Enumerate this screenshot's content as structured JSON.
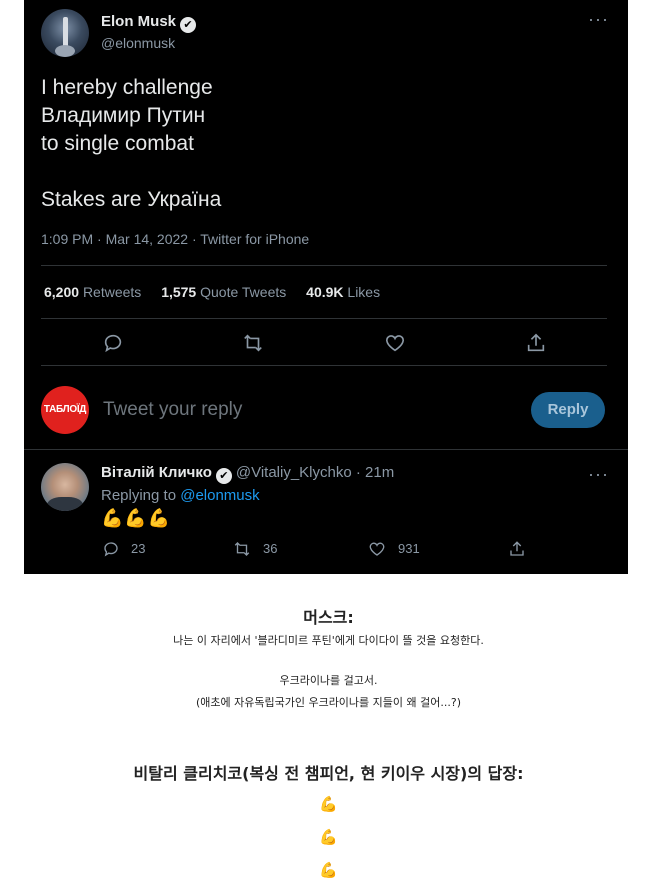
{
  "tweet": {
    "author_name": "Elon Musk",
    "author_handle": "@elonmusk",
    "verified_badge": "✔",
    "lines": [
      "I hereby challenge",
      "Владимир Путин",
      "to single combat",
      "Stakes are Україна"
    ],
    "meta": "1:09 PM · Mar 14, 2022 · Twitter for iPhone",
    "stats": {
      "retweets_count": "6,200",
      "retweets_label": "Retweets",
      "quotes_count": "1,575",
      "quotes_label": "Quote Tweets",
      "likes_count": "40.9K",
      "likes_label": "Likes"
    },
    "more_icon": "···"
  },
  "reply_box": {
    "avatar_text": "ТАБЛОЇД",
    "placeholder": "Tweet your reply",
    "button_label": "Reply"
  },
  "reply_tweet": {
    "author_name": "Віталій Кличко",
    "author_handle": "@Vitaliy_Klychko · 21m",
    "replying_prefix": "Replying to",
    "replying_handle": "@elonmusk",
    "emojis": "💪💪💪",
    "reply_count": "23",
    "retweet_count": "36",
    "like_count": "931"
  },
  "commentary": {
    "title": "머스크:",
    "line1": "나는 이 자리에서 '블라디미르 푸틴'에게 다이다이 뜰 것을 요청한다.",
    "line2": "우크라이나를 걸고서.",
    "line3": "(애초에 자유독립국가인 우크라이나를 지들이 왜 걸어...?)",
    "heading2": "비탈리 클리치코(복싱 전 챔피언, 현 키이우 시장)의 답장:",
    "emoji": "💪"
  },
  "colors": {
    "panel_bg": "#000000",
    "accent_link": "#1d9bf0",
    "reply_button_bg": "#1a5f8d",
    "tabloid_red": "#e0211e"
  }
}
